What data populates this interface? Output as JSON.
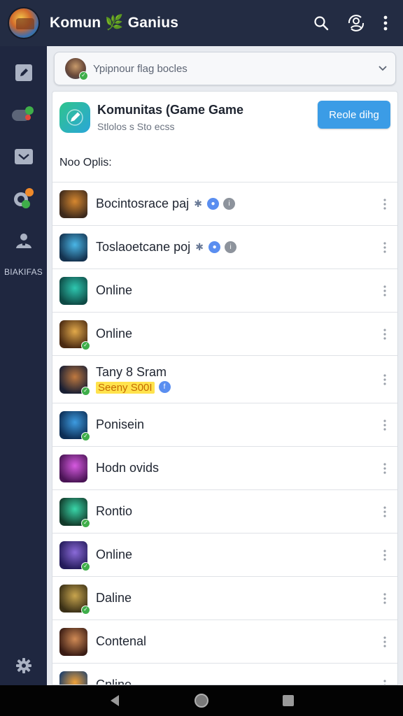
{
  "app": {
    "title": "Komun 🌿 Ganius"
  },
  "toolbar": {
    "search_icon": "search-icon",
    "profile_icon": "profile-sync-icon",
    "more_icon": "more-vert-icon"
  },
  "rail": {
    "label": "BIAKIFAS",
    "items": [
      "edit-icon",
      "gamepad-icon",
      "inbox-icon",
      "link-icon",
      "people-icon"
    ],
    "settings_icon": "gear-icon"
  },
  "search": {
    "placeholder": "Ypipnour flag bocles"
  },
  "community": {
    "title": "Komunitas (Game Game",
    "subtitle": "Stlolos s Sto ecss",
    "action_label": "Reole dihg"
  },
  "section": {
    "label": "Noo Oplis:"
  },
  "members": [
    {
      "name": "Bocintosrace paj",
      "extras": true,
      "avatar_colors": [
        "#3d2a1c",
        "#d6872f"
      ],
      "badge": false
    },
    {
      "name": "Toslaoetcane poj",
      "extras": true,
      "avatar_colors": [
        "#14324f",
        "#4ab6e6"
      ],
      "badge": false
    },
    {
      "name": "Online",
      "extras": false,
      "avatar_colors": [
        "#0e4a45",
        "#2ec7b0"
      ],
      "badge": false
    },
    {
      "name": "Online",
      "extras": false,
      "avatar_colors": [
        "#4a2a12",
        "#e2a94a"
      ],
      "badge": true
    },
    {
      "name": "Tany 8 Sram",
      "sub": "Seeny S00I",
      "extras": false,
      "avatar_colors": [
        "#1a1f33",
        "#c0793f"
      ],
      "badge": true
    },
    {
      "name": "Ponisein",
      "extras": false,
      "avatar_colors": [
        "#0d2e55",
        "#3d9be0"
      ],
      "badge": true
    },
    {
      "name": "Hodn ovids",
      "extras": false,
      "avatar_colors": [
        "#4a1455",
        "#d65ae0"
      ],
      "badge": false
    },
    {
      "name": "Rontio",
      "extras": false,
      "avatar_colors": [
        "#123a2a",
        "#39d6a9"
      ],
      "badge": true
    },
    {
      "name": "Online",
      "extras": false,
      "avatar_colors": [
        "#241b5a",
        "#8a6ad8"
      ],
      "badge": true
    },
    {
      "name": "Daline",
      "extras": false,
      "avatar_colors": [
        "#3a3016",
        "#c8a54e"
      ],
      "badge": true
    },
    {
      "name": "Contenal",
      "extras": false,
      "avatar_colors": [
        "#3a1c14",
        "#d08a55"
      ],
      "badge": false
    },
    {
      "name": "Cnline",
      "extras": false,
      "avatar_colors": [
        "#1d3f6a",
        "#f0a23a"
      ],
      "badge": false
    }
  ],
  "colors": {
    "appbar": "#232c43",
    "rail": "#1f2740",
    "accent": "#3b9ce6",
    "badge_green": "#3fae4a"
  },
  "system_nav": [
    "back-icon",
    "home-icon",
    "recents-icon"
  ]
}
